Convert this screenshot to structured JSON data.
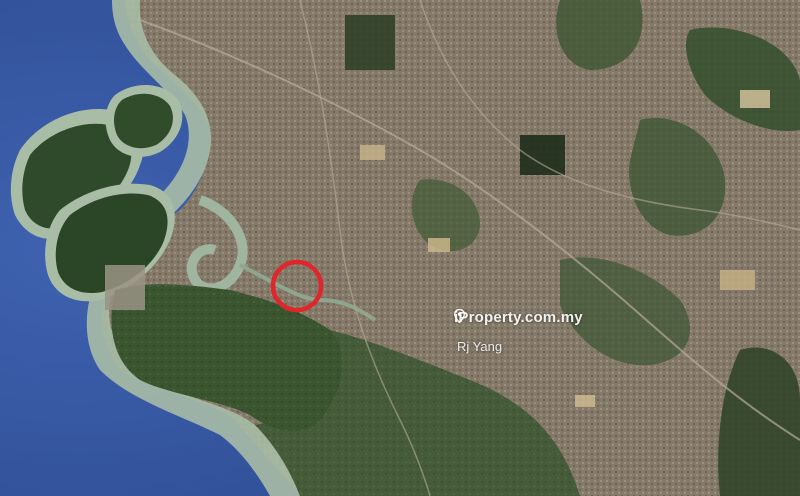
{
  "watermark": {
    "brand": "iProperty.com.my",
    "credit": "Rj Yang",
    "icon": "location-pin-icon"
  },
  "map": {
    "view": "satellite",
    "marker": {
      "shape": "circle",
      "color": "#e0262a"
    }
  },
  "colors": {
    "sea": "#3a5aa8",
    "shallow_water": "#9fb5a0",
    "mangrove": "#2f4a2a",
    "plantation": "#3d5a30",
    "urban": "#8c8273",
    "marker": "#e0262a"
  }
}
